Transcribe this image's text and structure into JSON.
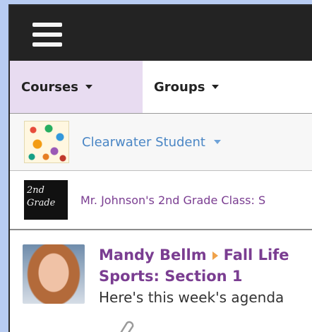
{
  "nav": {
    "courses_label": "Courses",
    "groups_label": "Groups"
  },
  "student": {
    "name": "Clearwater Student"
  },
  "course": {
    "thumb_text_line1": "2nd",
    "thumb_text_line2": "Grade",
    "name": "Mr. Johnson's 2nd Grade Class: S"
  },
  "post": {
    "author": "Mandy Bellm",
    "course_title": "Fall Life",
    "section": "Sports: Section 1",
    "text": "Here's this week's agenda"
  },
  "colors": {
    "topbar": "#232323",
    "courses_tab_bg": "#e8dcf1",
    "link_blue": "#4a86c5",
    "course_purple": "#7a3d91"
  }
}
